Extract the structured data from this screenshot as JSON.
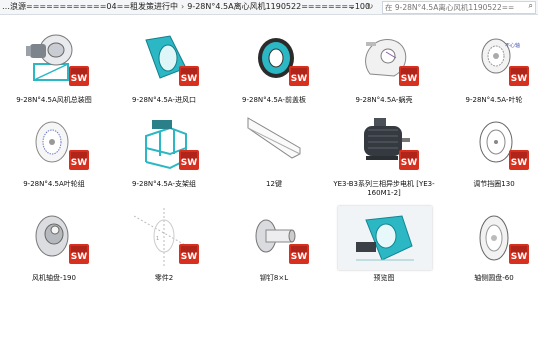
{
  "address_bar": {
    "crumbs": [
      "…浪源============04==租发策进行中",
      "9-28N°4.5A离心风机1190522========100"
    ],
    "separator": "›",
    "dropdown_icon": "chevron-down-icon",
    "refresh_icon": "refresh-icon",
    "search_placeholder": "在 9-28N°4.5A离心风机1190522======... ",
    "search_icon": "search-icon"
  },
  "colors": {
    "teal": "#2bb7c4",
    "sw_red": "#d7301f",
    "label": "#111111"
  },
  "files": [
    {
      "label": "9-28N°4.5A风机总装图",
      "kind": "assembly-fan",
      "sw": true
    },
    {
      "label": "9-28N°4.5A-进风口",
      "kind": "inlet",
      "sw": true
    },
    {
      "label": "9-28N°4.5A-前盖板",
      "kind": "ring",
      "sw": true
    },
    {
      "label": "9-28N°4.5A-蜗壳",
      "kind": "volute",
      "sw": true
    },
    {
      "label": "9-28N°4.5A-叶轮",
      "kind": "impeller",
      "sw": true
    },
    {
      "label": "9-28N°4.5A叶轮组",
      "kind": "wheel",
      "sw": true
    },
    {
      "label": "9-28N°4.5A-支架组",
      "kind": "stand",
      "sw": true
    },
    {
      "label": "12键",
      "kind": "key",
      "sw": false
    },
    {
      "label": "YE3-B3系列三相异步电机 [YE3-160M1-2]",
      "kind": "motor",
      "sw": true
    },
    {
      "label": "调节挡圈130",
      "kind": "disc",
      "sw": true
    },
    {
      "label": "风机轴盘-190",
      "kind": "hub",
      "sw": true
    },
    {
      "label": "零件2",
      "kind": "part2",
      "sw": true
    },
    {
      "label": "铆钉8×L",
      "kind": "rivet",
      "sw": true
    },
    {
      "label": "预览图",
      "kind": "preview",
      "sw": false
    },
    {
      "label": "轴侧圆盘-60",
      "kind": "pulley",
      "sw": true
    }
  ]
}
